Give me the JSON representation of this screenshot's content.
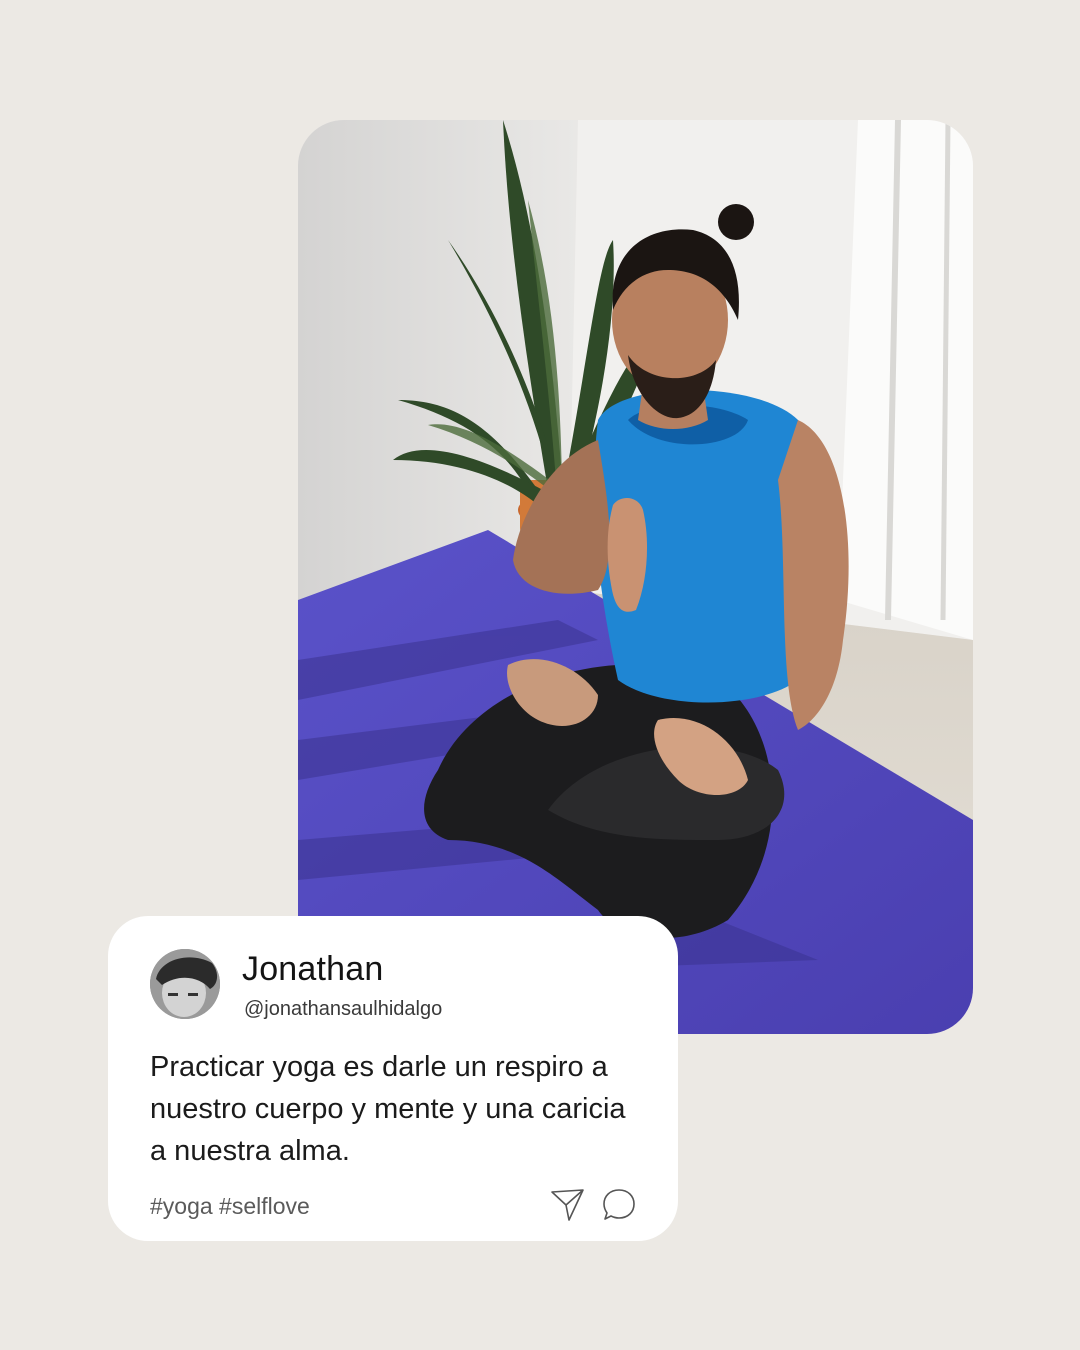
{
  "post": {
    "author": {
      "name": "Jonathan",
      "handle": "@jonathansaulhidalgo"
    },
    "text": "Practicar yoga es darle un respiro a nuestro cuerpo y mente y una caricia a nuestra alma.",
    "hashtags": "#yoga #selflove",
    "actions": {
      "share_icon": "send-icon",
      "comment_icon": "comment-icon"
    }
  },
  "colors": {
    "background": "#ece9e4",
    "card": "#ffffff",
    "mat": "#5b51c4",
    "tank_top": "#1c82d0"
  }
}
